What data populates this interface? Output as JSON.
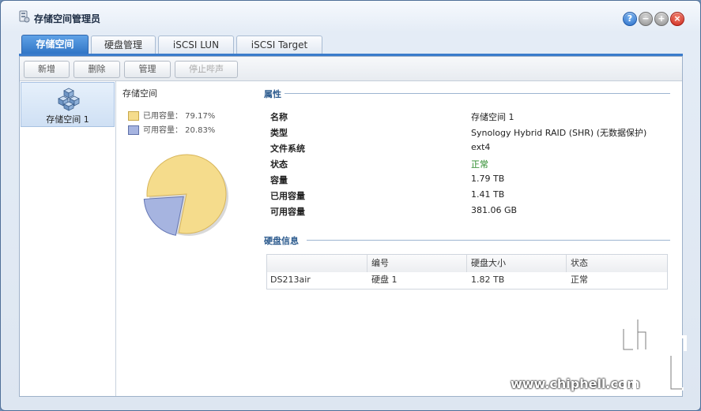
{
  "window": {
    "title": "存储空间管理员"
  },
  "tabs": [
    {
      "label": "存储空间"
    },
    {
      "label": "硬盘管理"
    },
    {
      "label": "iSCSI LUN"
    },
    {
      "label": "iSCSI Target"
    }
  ],
  "toolbar": {
    "create": "新增",
    "delete": "删除",
    "manage": "管理",
    "stop_beep": "停止哔声"
  },
  "volumes": [
    {
      "label": "存储空间 1"
    }
  ],
  "chart_section": {
    "title": "存储空间",
    "legend": [
      {
        "label": "已用容量： 79.17%",
        "color": "#f5dc8c"
      },
      {
        "label": "可用容量： 20.83%",
        "color": "#a6b4e0"
      }
    ]
  },
  "chart_data": {
    "type": "pie",
    "labels": [
      "已用容量",
      "可用容量"
    ],
    "values": [
      79.17,
      20.83
    ],
    "colors": [
      "#f5dc8c",
      "#a6b4e0"
    ]
  },
  "properties": {
    "title": "属性",
    "rows": [
      {
        "label": "名称",
        "value": "存储空间 1"
      },
      {
        "label": "类型",
        "value": "Synology Hybrid RAID (SHR) (无数据保护)"
      },
      {
        "label": "文件系统",
        "value": "ext4"
      },
      {
        "label": "状态",
        "value": "正常"
      },
      {
        "label": "容量",
        "value": "1.79 TB"
      },
      {
        "label": "已用容量",
        "value": "1.41 TB"
      },
      {
        "label": "可用容量",
        "value": "381.06 GB"
      }
    ]
  },
  "disk_info": {
    "title": "硬盘信息",
    "headers": [
      "",
      "编号",
      "硬盘大小",
      "状态"
    ],
    "rows": [
      {
        "name": "DS213air",
        "number": "硬盘 1",
        "size": "1.82 TB",
        "status": "正常"
      }
    ]
  },
  "watermark": {
    "text": "www.chiphell.com"
  }
}
